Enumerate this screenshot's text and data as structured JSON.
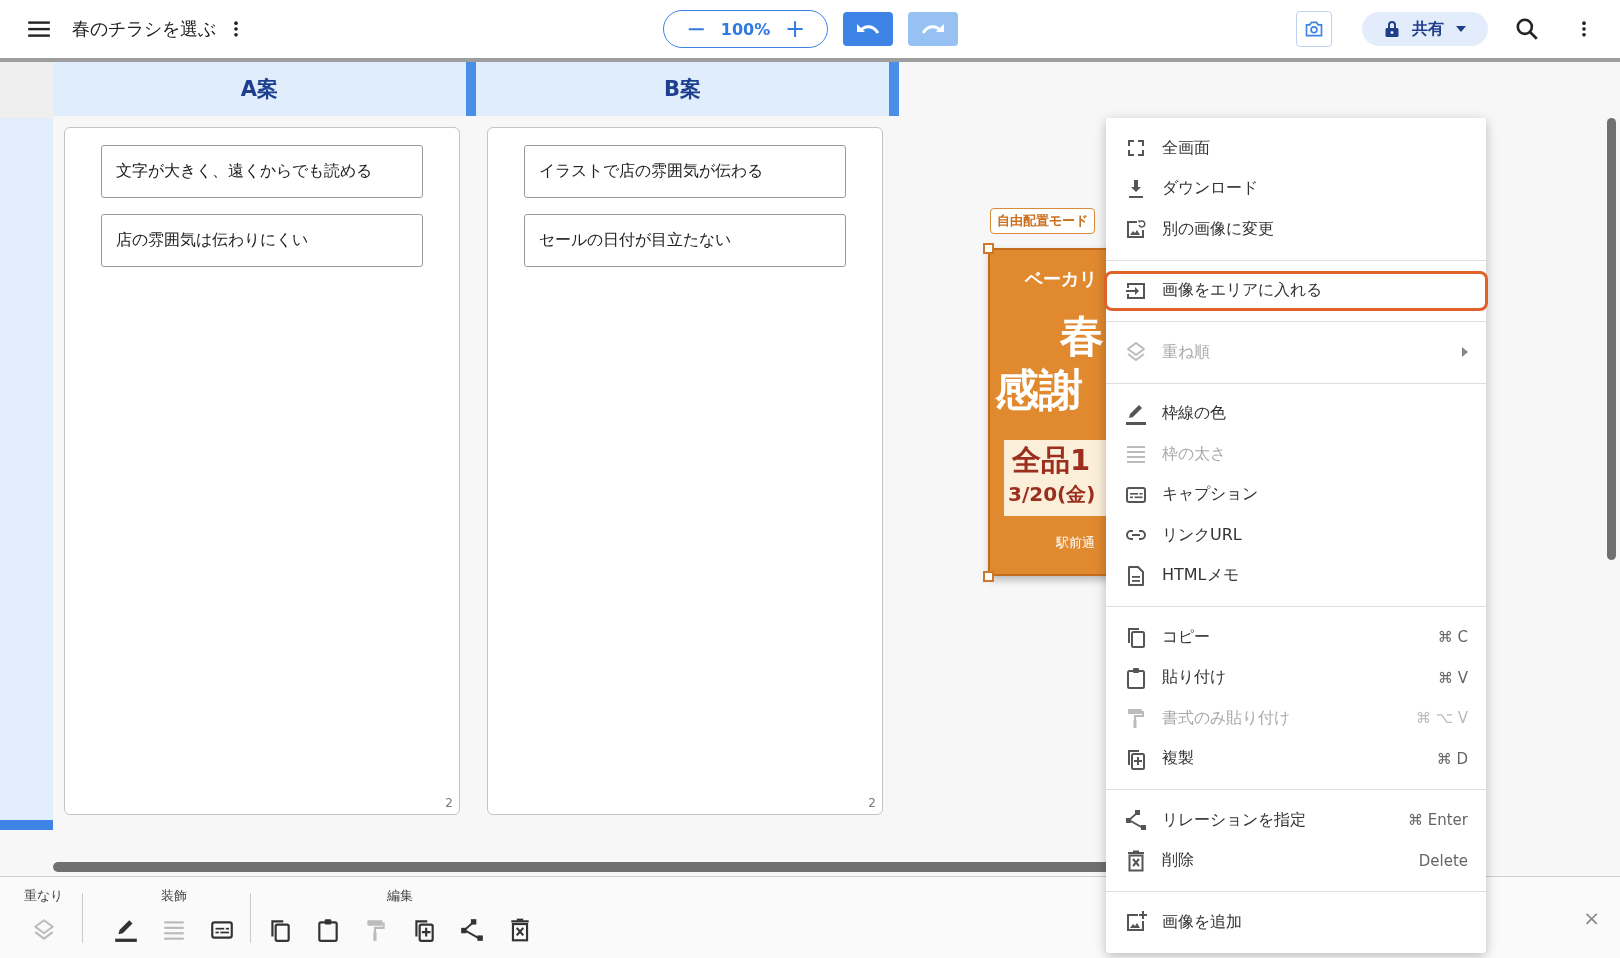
{
  "topbar": {
    "title": "春のチラシを選ぶ",
    "zoom": {
      "out": "−",
      "value": "100%",
      "in": "+"
    },
    "undo": {
      "disabled": false
    },
    "redo": {
      "disabled": true
    },
    "share": {
      "label": "共有"
    }
  },
  "columns": [
    {
      "title": "A案",
      "cards": [
        "文字が大きく、遠くからでも読める",
        "店の雰囲気は伝わりにくい"
      ],
      "count": "2"
    },
    {
      "title": "B案",
      "cards": [
        "イラストで店の雰囲気が伝わる",
        "セールの日付が目立たない"
      ],
      "count": "2"
    }
  ],
  "flyer": {
    "mode_tag": "自由配置モード",
    "shop": "ベーカリ",
    "headline_1": "春",
    "headline_2": "感謝",
    "offer": "全品1",
    "date": "3/20(金)",
    "address": "駅前通"
  },
  "context_menu": {
    "sections": [
      [
        {
          "kind": "fullscreen",
          "label": "全画面",
          "disabled": false,
          "selected": false,
          "submenu": false
        },
        {
          "kind": "download",
          "label": "ダウンロード",
          "disabled": false,
          "selected": false,
          "submenu": false
        },
        {
          "kind": "replace-image",
          "label": "別の画像に変更",
          "disabled": false,
          "selected": false,
          "submenu": false
        }
      ],
      [
        {
          "kind": "fit-area",
          "label": "画像をエリアに入れる",
          "disabled": false,
          "selected": true,
          "submenu": false
        }
      ],
      [
        {
          "kind": "layers",
          "label": "重ね順",
          "disabled": true,
          "selected": false,
          "submenu": true
        }
      ],
      [
        {
          "kind": "border-color",
          "label": "枠線の色",
          "disabled": false,
          "selected": false,
          "submenu": false
        },
        {
          "kind": "border-width",
          "label": "枠の太さ",
          "disabled": true,
          "selected": false,
          "submenu": false
        },
        {
          "kind": "caption",
          "label": "キャプション",
          "disabled": false,
          "selected": false,
          "submenu": false
        },
        {
          "kind": "link",
          "label": "リンクURL",
          "disabled": false,
          "selected": false,
          "submenu": false
        },
        {
          "kind": "html-memo",
          "label": "HTMLメモ",
          "disabled": false,
          "selected": false,
          "submenu": false
        }
      ],
      [
        {
          "kind": "copy",
          "label": "コピー",
          "shortcut": "⌘ C",
          "disabled": false,
          "selected": false,
          "submenu": false
        },
        {
          "kind": "paste",
          "label": "貼り付け",
          "shortcut": "⌘ V",
          "disabled": false,
          "selected": false,
          "submenu": false
        },
        {
          "kind": "format-paste",
          "label": "書式のみ貼り付け",
          "shortcut": "⌘ ⌥ V",
          "disabled": true,
          "selected": false,
          "submenu": false
        },
        {
          "kind": "duplicate",
          "label": "複製",
          "shortcut": "⌘ D",
          "disabled": false,
          "selected": false,
          "submenu": false
        }
      ],
      [
        {
          "kind": "relation",
          "label": "リレーションを指定",
          "shortcut": "⌘ Enter",
          "disabled": false,
          "selected": false,
          "submenu": false
        },
        {
          "kind": "delete",
          "label": "削除",
          "shortcut": "Delete",
          "disabled": false,
          "selected": false,
          "submenu": false
        }
      ],
      [
        {
          "kind": "add-image",
          "label": "画像を追加",
          "disabled": false,
          "selected": false,
          "submenu": false
        }
      ]
    ]
  },
  "bottom_toolbar": {
    "groups": [
      {
        "label": "重なり",
        "tools": [
          {
            "kind": "layers",
            "disabled": true
          }
        ]
      },
      {
        "label": "装飾",
        "tools": [
          {
            "kind": "border-color",
            "disabled": false
          },
          {
            "kind": "border-width",
            "disabled": true
          },
          {
            "kind": "caption",
            "disabled": false
          }
        ]
      },
      {
        "label": "編集",
        "tools": [
          {
            "kind": "copy",
            "disabled": false
          },
          {
            "kind": "paste",
            "disabled": false
          },
          {
            "kind": "format-paste",
            "disabled": true
          },
          {
            "kind": "duplicate",
            "disabled": false
          },
          {
            "kind": "relation",
            "disabled": false
          },
          {
            "kind": "delete",
            "disabled": false
          }
        ]
      }
    ],
    "close": "×"
  }
}
